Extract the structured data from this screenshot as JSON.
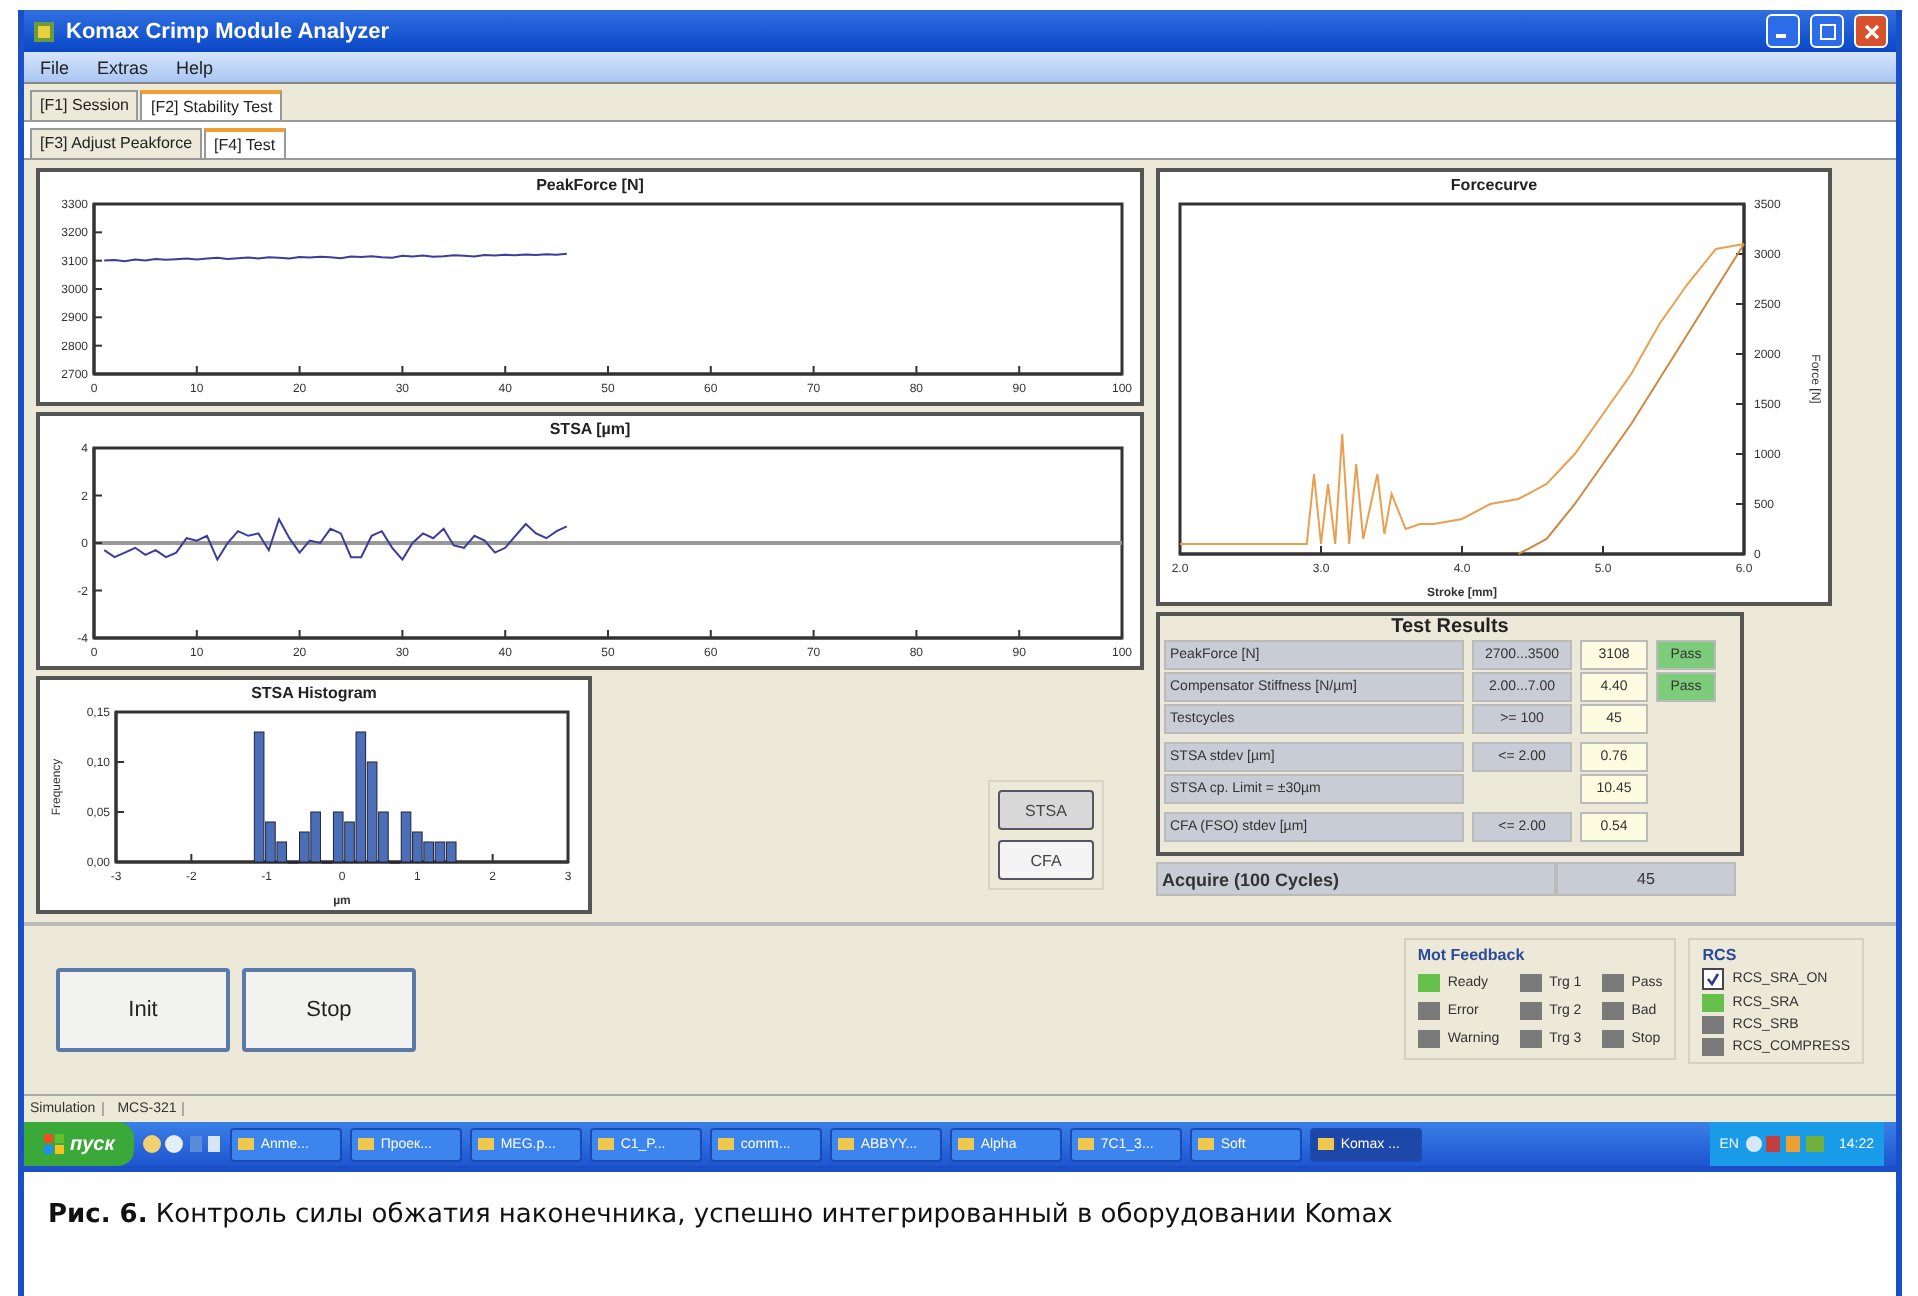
{
  "window": {
    "title": "Komax Crimp Module Analyzer"
  },
  "menu": [
    "File",
    "Extras",
    "Help"
  ],
  "tabs": [
    {
      "label": "[F1] Session",
      "selected": false
    },
    {
      "label": "[F2] Stability Test",
      "selected": true
    }
  ],
  "subtabs": [
    {
      "label": "[F3] Adjust Peakforce",
      "selected": false
    },
    {
      "label": "[F4] Test",
      "selected": true
    }
  ],
  "peakforce_chart": {
    "chart_data": {
      "type": "line",
      "title": "PeakForce [N]",
      "xlim": [
        0,
        100
      ],
      "ylim": [
        2700,
        3300
      ],
      "xticks": [
        0,
        10,
        20,
        30,
        40,
        50,
        60,
        70,
        80,
        90,
        100
      ],
      "yticks": [
        2700,
        2800,
        2900,
        3000,
        3100,
        3200,
        3300
      ],
      "x": [
        1,
        2,
        3,
        4,
        5,
        6,
        7,
        8,
        9,
        10,
        11,
        12,
        13,
        14,
        15,
        16,
        17,
        18,
        19,
        20,
        21,
        22,
        23,
        24,
        25,
        26,
        27,
        28,
        29,
        30,
        31,
        32,
        33,
        34,
        35,
        36,
        37,
        38,
        39,
        40,
        41,
        42,
        43,
        44,
        45,
        46
      ],
      "series": [
        {
          "color": "#3c3c9c",
          "values": [
            3100,
            3102,
            3098,
            3104,
            3101,
            3106,
            3103,
            3105,
            3108,
            3104,
            3107,
            3110,
            3106,
            3109,
            3111,
            3108,
            3112,
            3110,
            3107,
            3113,
            3111,
            3114,
            3112,
            3109,
            3115,
            3113,
            3116,
            3112,
            3110,
            3117,
            3115,
            3118,
            3114,
            3116,
            3119,
            3117,
            3115,
            3120,
            3118,
            3121,
            3119,
            3122,
            3120,
            3123,
            3121,
            3124
          ]
        }
      ]
    }
  },
  "stsa_chart": {
    "chart_data": {
      "type": "line",
      "title": "STSA [µm]",
      "xlim": [
        0,
        100
      ],
      "ylim": [
        -4,
        4
      ],
      "xticks": [
        0,
        10,
        20,
        30,
        40,
        50,
        60,
        70,
        80,
        90,
        100
      ],
      "yticks": [
        -4,
        -2,
        0,
        2,
        4
      ],
      "x": [
        1,
        2,
        3,
        4,
        5,
        6,
        7,
        8,
        9,
        10,
        11,
        12,
        13,
        14,
        15,
        16,
        17,
        18,
        19,
        20,
        21,
        22,
        23,
        24,
        25,
        26,
        27,
        28,
        29,
        30,
        31,
        32,
        33,
        34,
        35,
        36,
        37,
        38,
        39,
        40,
        41,
        42,
        43,
        44,
        45,
        46
      ],
      "series": [
        {
          "color": "#3c3c9c",
          "values": [
            -0.3,
            -0.6,
            -0.4,
            -0.2,
            -0.5,
            -0.3,
            -0.6,
            -0.4,
            0.2,
            0.1,
            0.3,
            -0.7,
            0.0,
            0.5,
            0.3,
            0.4,
            -0.3,
            1.0,
            0.2,
            -0.4,
            0.1,
            0.0,
            0.6,
            0.4,
            -0.6,
            -0.6,
            0.3,
            0.5,
            -0.2,
            -0.7,
            0.0,
            0.4,
            0.2,
            0.6,
            -0.1,
            -0.2,
            0.3,
            0.1,
            -0.4,
            -0.2,
            0.3,
            0.8,
            0.4,
            0.2,
            0.5,
            0.7
          ]
        }
      ]
    }
  },
  "histogram_chart": {
    "chart_data": {
      "type": "bar",
      "title": "STSA Histogram",
      "xlabel": "µm",
      "ylabel": "Frequency",
      "xlim": [
        -3,
        3
      ],
      "ylim": [
        0,
        0.15
      ],
      "xticks": [
        -3,
        -2,
        -1,
        0,
        1,
        2,
        3
      ],
      "yticks": [
        {
          "value": 0,
          "label": "0,00"
        },
        {
          "value": 0.05,
          "label": "0,05"
        },
        {
          "value": 0.1,
          "label": "0,10"
        },
        {
          "value": 0.15,
          "label": "0,15"
        }
      ],
      "x": [
        -1.1,
        -0.95,
        -0.8,
        -0.65,
        -0.5,
        -0.35,
        -0.2,
        -0.05,
        0.1,
        0.25,
        0.4,
        0.55,
        0.7,
        0.85,
        1.0,
        1.15,
        1.3,
        1.45
      ],
      "series": [
        {
          "color": "#4a6fb8",
          "values": [
            0.13,
            0.04,
            0.02,
            0.0,
            0.03,
            0.05,
            0.0,
            0.05,
            0.04,
            0.13,
            0.1,
            0.05,
            0.0,
            0.05,
            0.03,
            0.02,
            0.02,
            0.02
          ]
        }
      ]
    }
  },
  "view_buttons": [
    {
      "label": "STSA",
      "selected": true
    },
    {
      "label": "CFA",
      "selected": false
    }
  ],
  "forcecurve_chart": {
    "chart_data": {
      "type": "line",
      "title": "Forcecurve",
      "xlabel": "Stroke [mm]",
      "ylabel": "Force [N]",
      "xlim": [
        2,
        6
      ],
      "ylim": [
        0,
        3500
      ],
      "xticks": [
        {
          "value": 2,
          "label": "2.0"
        },
        {
          "value": 3,
          "label": "3.0"
        },
        {
          "value": 4,
          "label": "4.0"
        },
        {
          "value": 5,
          "label": "5.0"
        },
        {
          "value": 6,
          "label": "6.0"
        }
      ],
      "yticks": [
        0,
        500,
        1000,
        1500,
        2000,
        2500,
        3000,
        3500
      ],
      "x": [
        2.0,
        2.6,
        2.9,
        2.95,
        3.0,
        3.05,
        3.1,
        3.15,
        3.2,
        3.25,
        3.3,
        3.4,
        3.45,
        3.5,
        3.6,
        3.7,
        3.8,
        4.0,
        4.2,
        4.4,
        4.6,
        4.8,
        5.0,
        5.2,
        5.4,
        5.6,
        5.8,
        6.0
      ],
      "series": [
        {
          "color": "#e8a050",
          "values": [
            100,
            100,
            100,
            800,
            100,
            700,
            100,
            1200,
            100,
            900,
            150,
            800,
            200,
            600,
            250,
            300,
            300,
            350,
            500,
            550,
            700,
            1000,
            1400,
            1800,
            2300,
            2700,
            3050,
            3100
          ]
        },
        {
          "color": "#d08840",
          "values": [
            null,
            null,
            null,
            null,
            null,
            null,
            null,
            null,
            null,
            null,
            null,
            null,
            null,
            null,
            null,
            null,
            null,
            null,
            null,
            0,
            150,
            500,
            900,
            1300,
            1750,
            2200,
            2650,
            3100
          ]
        }
      ]
    }
  },
  "test_results": {
    "title": "Test Results",
    "groups": [
      [
        {
          "label": "PeakForce [N]",
          "range": "2700...3500",
          "value": "3108",
          "verdict": "Pass"
        },
        {
          "label": "Compensator Stiffness [N/µm]",
          "range": "2.00...7.00",
          "value": "4.40",
          "verdict": "Pass"
        },
        {
          "label": "Testcycles",
          "range": ">= 100",
          "value": "45"
        }
      ],
      [
        {
          "label": "STSA stdev [µm]",
          "range": "<= 2.00",
          "value": "0.76"
        },
        {
          "label": "STSA cp. Limit = ±30µm",
          "value": "10.45"
        }
      ],
      [
        {
          "label": "CFA (FSO) stdev [µm]",
          "range": "<= 2.00",
          "value": "0.54"
        }
      ]
    ]
  },
  "acquire": {
    "label": "Acquire (100 Cycles)",
    "value": "45"
  },
  "action_buttons": [
    "Init",
    "Stop"
  ],
  "mot_feedback": {
    "title": "Mot Feedback",
    "items": [
      {
        "label": "Ready",
        "on": true
      },
      {
        "label": "Error",
        "on": false
      },
      {
        "label": "Warning",
        "on": false
      },
      {
        "label": "Trg 1",
        "on": false
      },
      {
        "label": "Trg 2",
        "on": false
      },
      {
        "label": "Trg 3",
        "on": false
      },
      {
        "label": "Pass",
        "on": false
      },
      {
        "label": "Bad",
        "on": false
      },
      {
        "label": "Stop",
        "on": false
      }
    ]
  },
  "rcs": {
    "title": "RCS",
    "items": [
      {
        "kind": "checkbox",
        "label": "RCS_SRA_ON",
        "checked": true
      },
      {
        "kind": "lamp",
        "label": "RCS_SRA",
        "on": true
      },
      {
        "kind": "lamp",
        "label": "RCS_SRB",
        "on": false
      },
      {
        "kind": "lamp",
        "label": "RCS_COMPRESS",
        "on": false
      }
    ]
  },
  "status_bar": [
    "Simulation",
    "MCS-321"
  ],
  "taskbar": {
    "start": "пуск",
    "tasks": [
      "Anme...",
      "Проек...",
      "MEG.p...",
      "C1_P...",
      "comm...",
      "ABBYY...",
      "Alpha",
      "7C1_3...",
      "Soft",
      "Komax ..."
    ],
    "language": "EN",
    "clock": "14:22"
  },
  "caption": "**Рис. 6.** Контроль силы обжатия наконечника, успешно интегрированный в оборудовании Komax"
}
